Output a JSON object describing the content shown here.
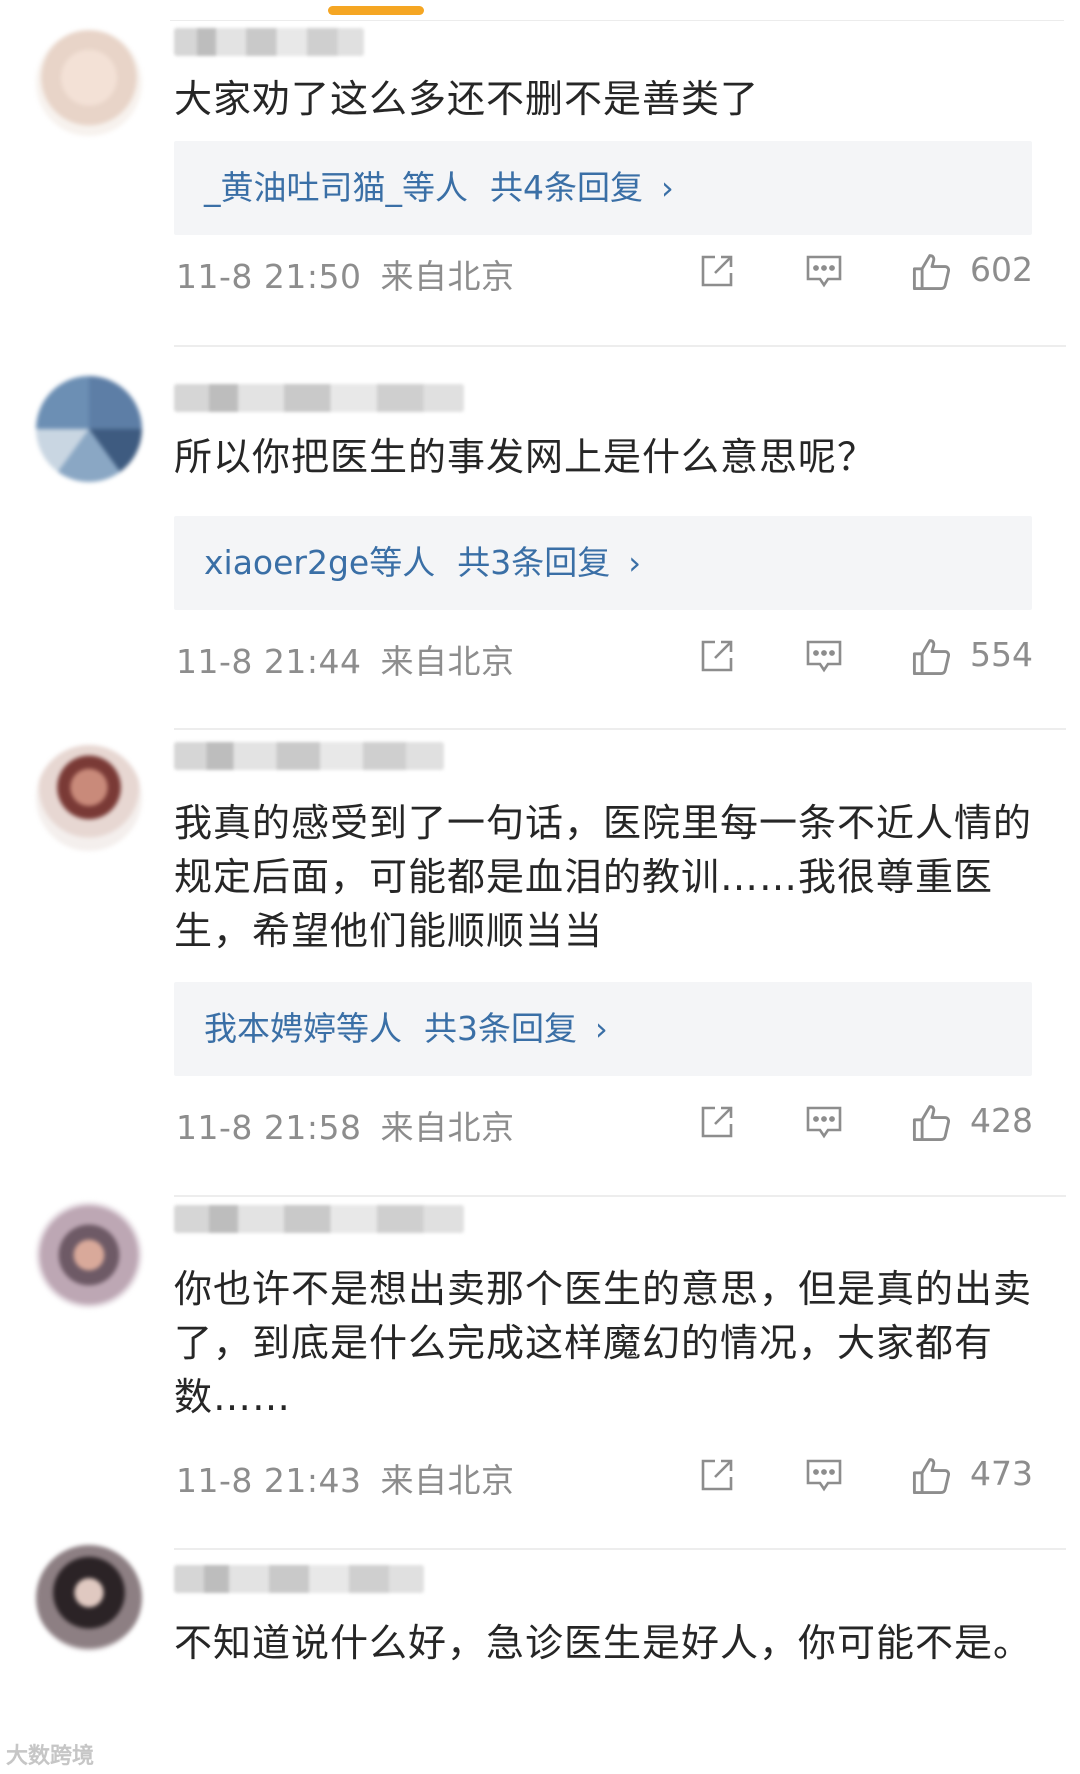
{
  "comments": [
    {
      "text": "大家劝了这么多还不删不是善类了",
      "reply_names": "_黄油吐司猫_",
      "reply_suffix": "等人",
      "reply_count": "共4条回复",
      "time": "11-8 21:50",
      "location": "来自北京",
      "likes": "602"
    },
    {
      "text": "所以你把医生的事发网上是什么意思呢？",
      "reply_names": "xiaoer2ge",
      "reply_suffix": "等人",
      "reply_count": "共3条回复",
      "time": "11-8 21:44",
      "location": "来自北京",
      "likes": "554"
    },
    {
      "text": "我真的感受到了一句话，医院里每一条不近人情的规定后面，可能都是血泪的教训……我很尊重医生，希望他们能顺顺当当",
      "reply_names": "我本娉婷",
      "reply_suffix": "等人",
      "reply_count": "共3条回复",
      "time": "11-8 21:58",
      "location": "来自北京",
      "likes": "428"
    },
    {
      "text": "你也许不是想出卖那个医生的意思，但是真的出卖了，到底是什么完成这样魔幻的情况，大家都有数……",
      "time": "11-8 21:43",
      "location": "来自北京",
      "likes": "473"
    },
    {
      "text": "不知道说什么好，急诊医生是好人，你可能不是。"
    }
  ],
  "reply_chevron": "›",
  "watermark": "大数跨境",
  "icons": [
    "share-icon",
    "comment-icon",
    "like-icon"
  ],
  "colors": {
    "link": "#3a6fa6",
    "meta": "#8d8d8d",
    "reply_bg": "#f4f5f7",
    "indicator": "#f5a623"
  }
}
